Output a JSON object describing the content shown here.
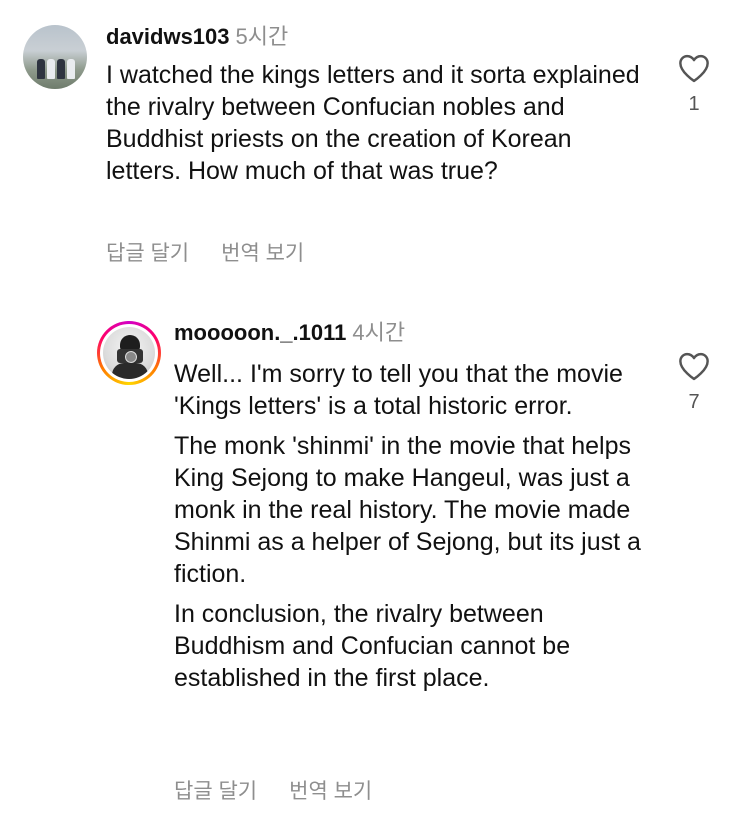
{
  "comment": {
    "username": "davidws103",
    "time": "5시간",
    "text": "I watched the kings letters and it sorta explained the rivalry between Confucian nobles and Buddhist priests on the creation of Korean letters. How much of that was true?",
    "likes": "1",
    "reply_label": "답글 달기",
    "translate_label": "번역 보기"
  },
  "reply": {
    "username": "mooooon._.1011",
    "time": "4시간",
    "paragraphs": [
      "Well... I'm sorry to tell you that the movie 'Kings letters' is a total historic error.",
      "The monk 'shinmi' in the movie that helps King Sejong to make Hangeul, was just a monk in the real history. The movie made Shinmi as a helper of Sejong, but its just a fiction.",
      "In conclusion, the rivalry between Buddhism and Confucian cannot be established in the first place."
    ],
    "likes": "7",
    "reply_label": "답글 달기",
    "translate_label": "번역 보기"
  },
  "icons": {
    "like": "heart-outline-icon"
  }
}
